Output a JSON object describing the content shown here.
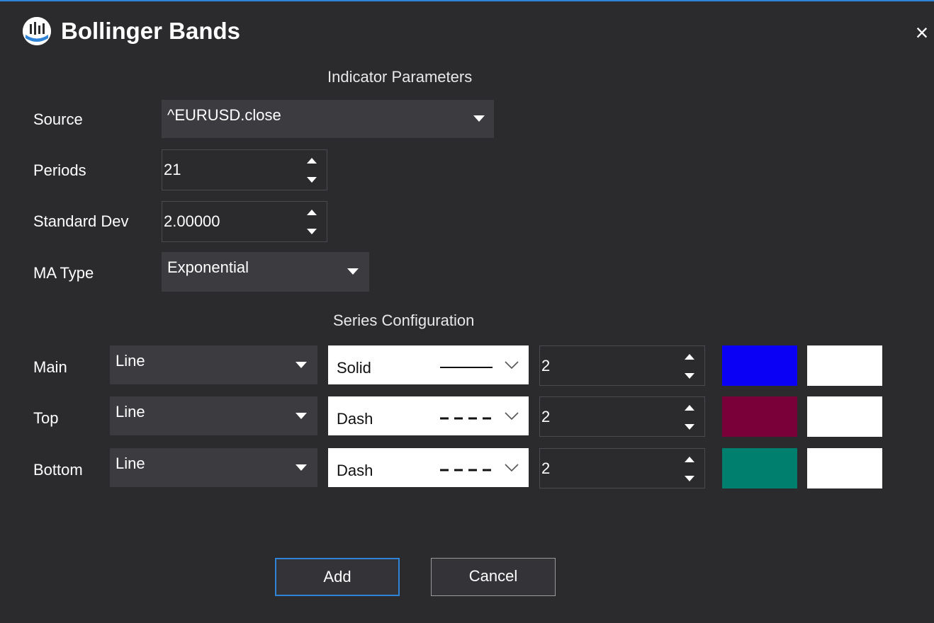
{
  "window": {
    "title": "Bollinger Bands",
    "close_glyph": "×"
  },
  "indicator_params": {
    "heading": "Indicator Parameters",
    "source": {
      "label": "Source",
      "value": "^EURUSD.close"
    },
    "periods": {
      "label": "Periods",
      "value": "21"
    },
    "std_dev": {
      "label": "Standard Dev",
      "value": "2.00000"
    },
    "ma_type": {
      "label": "MA Type",
      "value": "Exponential"
    }
  },
  "series_config": {
    "heading": "Series Configuration",
    "rows": [
      {
        "label": "Main",
        "type": "Line",
        "style": "Solid",
        "style_pattern": "solid",
        "width": "2",
        "color": "#0a00f5",
        "fill": "#ffffff"
      },
      {
        "label": "Top",
        "type": "Line",
        "style": "Dash",
        "style_pattern": "dash",
        "width": "2",
        "color": "#7a003a",
        "fill": "#ffffff"
      },
      {
        "label": "Bottom",
        "type": "Line",
        "style": "Dash",
        "style_pattern": "dash",
        "width": "2",
        "color": "#007f6e",
        "fill": "#ffffff"
      }
    ]
  },
  "buttons": {
    "add": "Add",
    "cancel": "Cancel"
  },
  "colors": {
    "background": "#2b2b2e",
    "control": "#3b3b40",
    "accent": "#2f84d8"
  },
  "icons": {
    "app": "bollinger-bands-icon",
    "close": "close-icon",
    "dropdown": "chevron-down-icon",
    "spinner": "spinner-arrows-icon"
  }
}
